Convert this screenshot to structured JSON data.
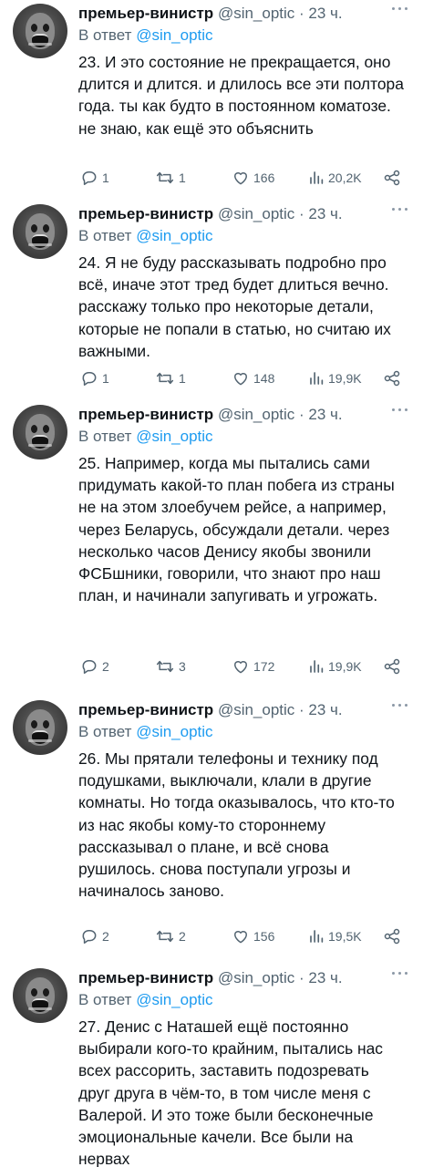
{
  "tweets": [
    {
      "author": "премьер-винистр",
      "handle": "@sin_optic",
      "time": "· 23 ч.",
      "reply_prefix": "В ответ",
      "reply_to": "@sin_optic",
      "text": "23. И это состояние не прекращается, оно длится и длится. и длилось все эти полтора года. ты как будто в постоянном коматозе. не знаю, как ещё это объяснить",
      "replies": "1",
      "retweets": "1",
      "likes": "166",
      "views": "20,2K"
    },
    {
      "author": "премьер-винистр",
      "handle": "@sin_optic",
      "time": "· 23 ч.",
      "reply_prefix": "В ответ",
      "reply_to": "@sin_optic",
      "text": "24. Я не буду рассказывать подробно про всё, иначе этот тред будет длиться вечно. расскажу только про некоторые детали, которые не попали в статью, но считаю их важными.",
      "replies": "1",
      "retweets": "1",
      "likes": "148",
      "views": "19,9K"
    },
    {
      "author": "премьер-винистр",
      "handle": "@sin_optic",
      "time": "· 23 ч.",
      "reply_prefix": "В ответ",
      "reply_to": "@sin_optic",
      "text": "25. Например, когда мы пытались сами придумать какой-то план побега из страны не на этом злоебучем рейсе, а например, через Беларусь, обсуждали детали. через несколько часов Денису  якобы звонили ФСБшники, говорили, что знают про наш план, и начинали запугивать и угрожать.",
      "replies": "2",
      "retweets": "3",
      "likes": "172",
      "views": "19,9K"
    },
    {
      "author": "премьер-винистр",
      "handle": "@sin_optic",
      "time": "· 23 ч.",
      "reply_prefix": "В ответ",
      "reply_to": "@sin_optic",
      "text": "26. Мы прятали телефоны и технику под подушками, выключали, клали в другие комнаты. Но тогда оказывалось, что кто-то из нас якобы кому-то стороннему рассказывал о плане, и всё снова рушилось. снова поступали угрозы и начиналось заново.",
      "replies": "2",
      "retweets": "2",
      "likes": "156",
      "views": "19,5K"
    },
    {
      "author": "премьер-винистр",
      "handle": "@sin_optic",
      "time": "· 23 ч.",
      "reply_prefix": "В ответ",
      "reply_to": "@sin_optic",
      "text": "27. Денис с Наташей ещё постоянно выбирали кого-то крайним, пытались нас всех рассорить, заставить подозревать друг друга в чём-то, в том числе меня с Валерой. И это тоже были бесконечные эмоциональные качели. Все были на нервах",
      "replies": "",
      "retweets": "",
      "likes": "",
      "views": ""
    }
  ],
  "colors": {
    "text": "#0f1419",
    "muted": "#536471",
    "link": "#1d9bf0",
    "background": "#ffffff"
  },
  "icons": [
    "more-icon",
    "reply-icon",
    "retweet-icon",
    "like-icon",
    "views-icon",
    "share-icon"
  ]
}
